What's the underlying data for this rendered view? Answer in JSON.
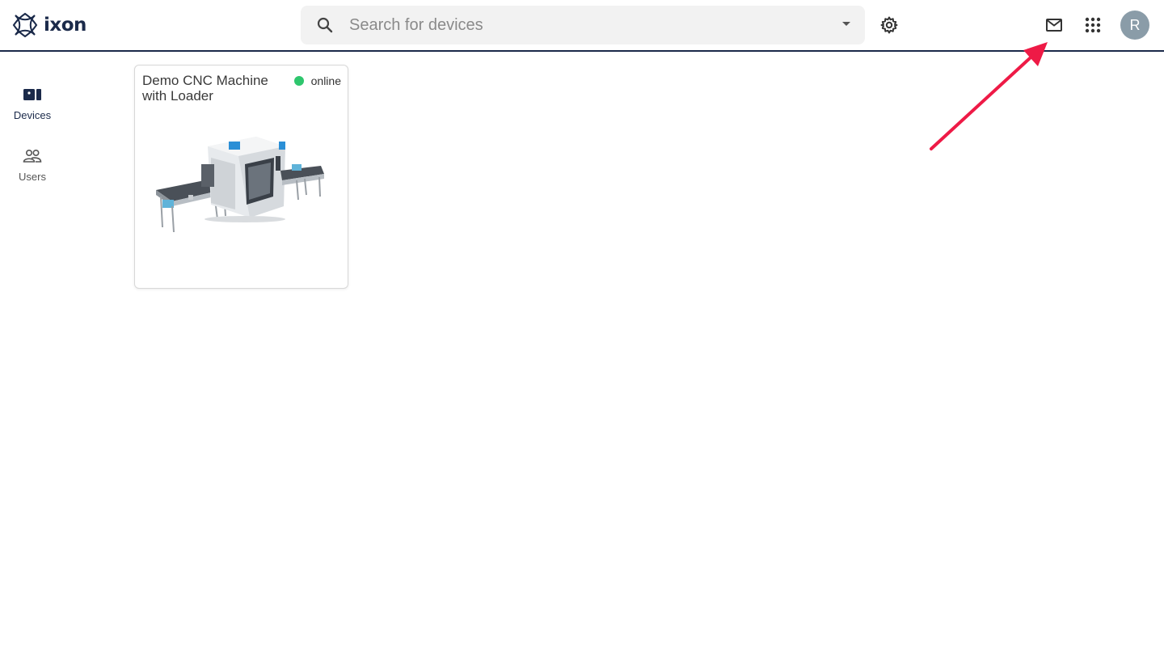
{
  "app": {
    "brand": "ixon"
  },
  "search": {
    "placeholder": "Search for devices",
    "value": ""
  },
  "header": {
    "settings_icon": "gear-icon",
    "mail_icon": "mail-icon",
    "apps_icon": "apps-grid-icon",
    "avatar_initial": "R"
  },
  "sidebar": {
    "items": [
      {
        "label": "Devices",
        "icon": "devices-icon",
        "active": true
      },
      {
        "label": "Users",
        "icon": "users-icon",
        "active": false
      }
    ]
  },
  "devices": [
    {
      "name": "Demo CNC Machine with Loader",
      "status": "online",
      "status_color": "#2ec66d"
    }
  ],
  "colors": {
    "brand": "#1b2a4a",
    "annotation_arrow": "#ee1a46"
  }
}
